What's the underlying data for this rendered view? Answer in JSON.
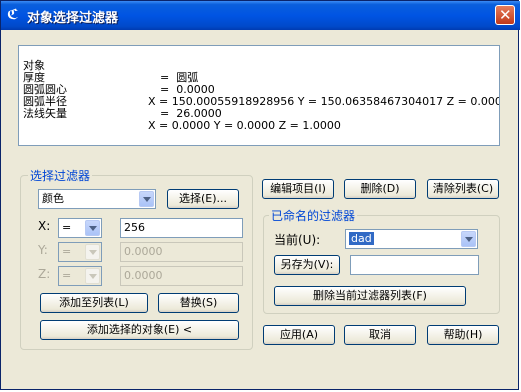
{
  "window": {
    "title": "对象选择过滤器"
  },
  "info_list": [
    {
      "key": "对象",
      "value": "=  圆弧"
    },
    {
      "key": "厚度",
      "value": "=  0.0000"
    },
    {
      "key": "圆弧圆心",
      "value": "X = 150.00055918928956 Y = 150.06358467304017 Z = 0.0000"
    },
    {
      "key": "圆弧半径",
      "value": "=  26.0000"
    },
    {
      "key": "法线矢量",
      "value": "X = 0.0000 Y = 0.0000 Z = 1.0000"
    }
  ],
  "filter_group": {
    "legend": "选择过滤器",
    "type_combo": "颜色",
    "select_button": "选择(E)...",
    "x_label": "X:",
    "x_op": "=",
    "x_value": "256",
    "y_label": "Y:",
    "y_op": "=",
    "y_value": "0.0000",
    "z_label": "Z:",
    "z_op": "=",
    "z_value": "0.0000",
    "add_to_list": "添加至列表(L)",
    "replace": "替换(S)",
    "add_selected": "添加选择的对象(E) <"
  },
  "list_buttons": {
    "edit": "编辑项目(I)",
    "delete": "删除(D)",
    "clear": "清除列表(C)"
  },
  "named_group": {
    "legend": "已命名的过滤器",
    "current_label": "当前(U):",
    "current_value": "dad",
    "save_as": "另存为(V):",
    "save_as_value": "",
    "delete_current": "删除当前过滤器列表(F)"
  },
  "footer": {
    "apply": "应用(A)",
    "cancel": "取消",
    "help": "帮助(H)"
  }
}
